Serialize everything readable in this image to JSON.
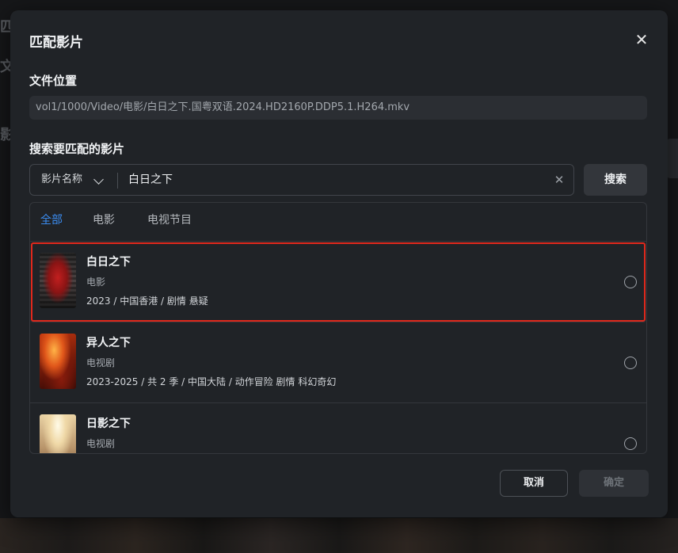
{
  "background": {
    "fragments": [
      "匹",
      "文",
      "影"
    ]
  },
  "dialog": {
    "title": "匹配影片",
    "close_icon": "close-icon"
  },
  "file_location": {
    "label": "文件位置",
    "path": "vol1/1000/Video/电影/白日之下.国粤双语.2024.HD2160P.DDP5.1.H264.mkv"
  },
  "search": {
    "label": "搜索要匹配的影片",
    "type_selected": "影片名称",
    "query": "白日之下",
    "clear_icon": "clear-icon",
    "button_label": "搜索"
  },
  "tabs": [
    {
      "label": "全部",
      "active": true
    },
    {
      "label": "电影",
      "active": false
    },
    {
      "label": "电视节目",
      "active": false
    }
  ],
  "results": [
    {
      "title": "白日之下",
      "type": "电影",
      "meta": "2023 / 中国香港 / 剧情 悬疑",
      "highlighted": true
    },
    {
      "title": "异人之下",
      "type": "电视剧",
      "meta": "2023-2025 / 共 2 季 / 中国大陆 / 动作冒险 剧情 科幻奇幻",
      "highlighted": false
    },
    {
      "title": "日影之下",
      "type": "电视剧",
      "meta": "",
      "highlighted": false
    }
  ],
  "footer": {
    "cancel_label": "取消",
    "confirm_label": "确定"
  },
  "colors": {
    "accent": "#3b8cf0",
    "highlight_border": "#e0281c",
    "dialog_bg": "#202327"
  }
}
